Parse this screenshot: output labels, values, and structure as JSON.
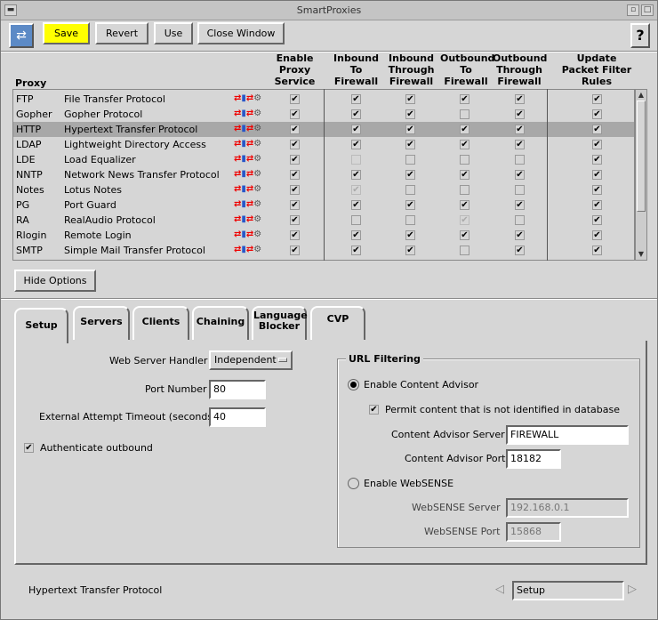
{
  "window": {
    "title": "SmartProxies"
  },
  "toolbar": {
    "save": "Save",
    "revert": "Revert",
    "use": "Use",
    "close": "Close Window",
    "help": "?"
  },
  "headers": {
    "proxy": "Proxy",
    "enable": "Enable Proxy Service",
    "in_to": "Inbound To Firewall",
    "in_through": "Inbound Through Firewall",
    "out_to": "Outbound To Firewall",
    "out_through": "Outbound Through Firewall",
    "update": "Update Packet Filter Rules"
  },
  "rows": [
    {
      "code": "FTP",
      "name": "File Transfer Protocol",
      "checks": [
        1,
        1,
        1,
        1,
        1,
        1
      ]
    },
    {
      "code": "Gopher",
      "name": "Gopher Protocol",
      "checks": [
        1,
        1,
        1,
        0,
        1,
        1
      ]
    },
    {
      "code": "HTTP",
      "name": "Hypertext Transfer Protocol",
      "checks": [
        1,
        1,
        1,
        1,
        1,
        1
      ],
      "selected": true
    },
    {
      "code": "LDAP",
      "name": "Lightweight Directory Access",
      "checks": [
        1,
        1,
        1,
        1,
        1,
        1
      ]
    },
    {
      "code": "LDE",
      "name": "Load Equalizer",
      "checks": [
        1,
        2,
        0,
        0,
        0,
        1
      ]
    },
    {
      "code": "NNTP",
      "name": "Network News Transfer Protocol",
      "checks": [
        1,
        1,
        1,
        1,
        1,
        1
      ]
    },
    {
      "code": "Notes",
      "name": "Lotus Notes",
      "checks": [
        1,
        3,
        0,
        0,
        0,
        1
      ]
    },
    {
      "code": "PG",
      "name": "Port Guard",
      "checks": [
        1,
        1,
        1,
        1,
        1,
        1
      ]
    },
    {
      "code": "RA",
      "name": "RealAudio Protocol",
      "checks": [
        1,
        0,
        0,
        3,
        0,
        1
      ]
    },
    {
      "code": "Rlogin",
      "name": "Remote Login",
      "checks": [
        1,
        1,
        1,
        1,
        1,
        1
      ]
    },
    {
      "code": "SMTP",
      "name": "Simple Mail Transfer Protocol",
      "checks": [
        1,
        1,
        1,
        0,
        1,
        1
      ]
    }
  ],
  "hide_options": "Hide Options",
  "tabs": [
    "Setup",
    "Servers",
    "Clients",
    "Chaining",
    "Language Blocker",
    "CVP"
  ],
  "setup": {
    "web_handler_label": "Web Server Handler",
    "web_handler_value": "Independent",
    "port_label": "Port Number",
    "port_value": "80",
    "timeout_label": "External Attempt Timeout (seconds)",
    "timeout_value": "40",
    "auth_label": "Authenticate outbound"
  },
  "url_filtering": {
    "title": "URL Filtering",
    "content_advisor": "Enable Content Advisor",
    "permit": "Permit content that is not identified in database",
    "ca_server_label": "Content Advisor Server",
    "ca_server_value": "FIREWALL",
    "ca_port_label": "Content Advisor Port",
    "ca_port_value": "18182",
    "websense": "Enable WebSENSE",
    "ws_server_label": "WebSENSE Server",
    "ws_server_value": "192.168.0.1",
    "ws_port_label": "WebSENSE Port",
    "ws_port_value": "15868"
  },
  "status": {
    "left": "Hypertext Transfer Protocol",
    "right": "Setup"
  }
}
